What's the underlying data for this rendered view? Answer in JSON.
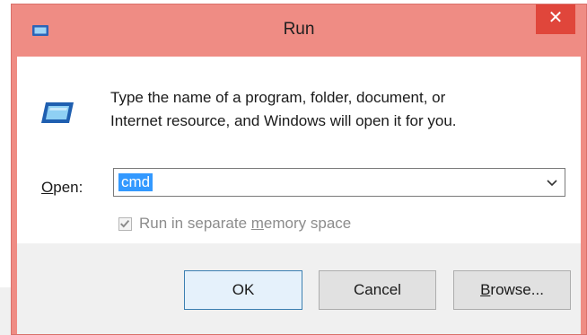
{
  "window": {
    "title": "Run",
    "close_glyph": "✕",
    "icon": "run-icon"
  },
  "description_line1": "Type the name of a program, folder, document, or",
  "description_line2": "Internet resource, and Windows will open it for you.",
  "open": {
    "label_prefix": "",
    "label_mnemonic": "O",
    "label_rest": "pen:",
    "value": "cmd"
  },
  "checkbox": {
    "label_before": "Run in separate ",
    "label_mnemonic": "m",
    "label_after": "emory space",
    "checked": true
  },
  "buttons": {
    "ok": "OK",
    "cancel": "Cancel",
    "browse_mnemonic": "B",
    "browse_rest": "rowse..."
  },
  "colors": {
    "titlebar": "#ef8c84",
    "close": "#e0463b",
    "selection": "#3399ff"
  }
}
